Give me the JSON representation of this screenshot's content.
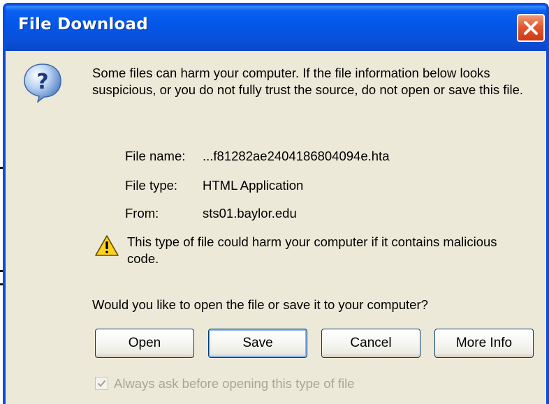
{
  "window": {
    "title": "File Download"
  },
  "message": {
    "intro": "Some files can harm your computer. If the file information below looks suspicious, or you do not fully trust the source, do not open or save this file."
  },
  "file_info": {
    "name_label": "File name:",
    "name_value": "...f81282ae2404186804094e.hta",
    "type_label": "File type:",
    "type_value": "HTML Application",
    "from_label": "From:",
    "from_value": "sts01.baylor.edu"
  },
  "warning": {
    "text": "This type of file could harm your computer if it contains malicious code."
  },
  "question": "Would you like to open the file or save it to your computer?",
  "buttons": {
    "open": "Open",
    "save": "Save",
    "cancel": "Cancel",
    "more_info": "More Info"
  },
  "checkbox": {
    "label": "Always ask before opening this type of file",
    "checked": true,
    "disabled": true
  },
  "icons": {
    "question": "question-icon",
    "warning": "warning-icon",
    "close": "close-icon"
  },
  "colors": {
    "titlebar": "#0356e8",
    "dialog_bg": "#ece9d8",
    "close_button": "#e2582f",
    "disabled_text": "#a9a59a"
  }
}
